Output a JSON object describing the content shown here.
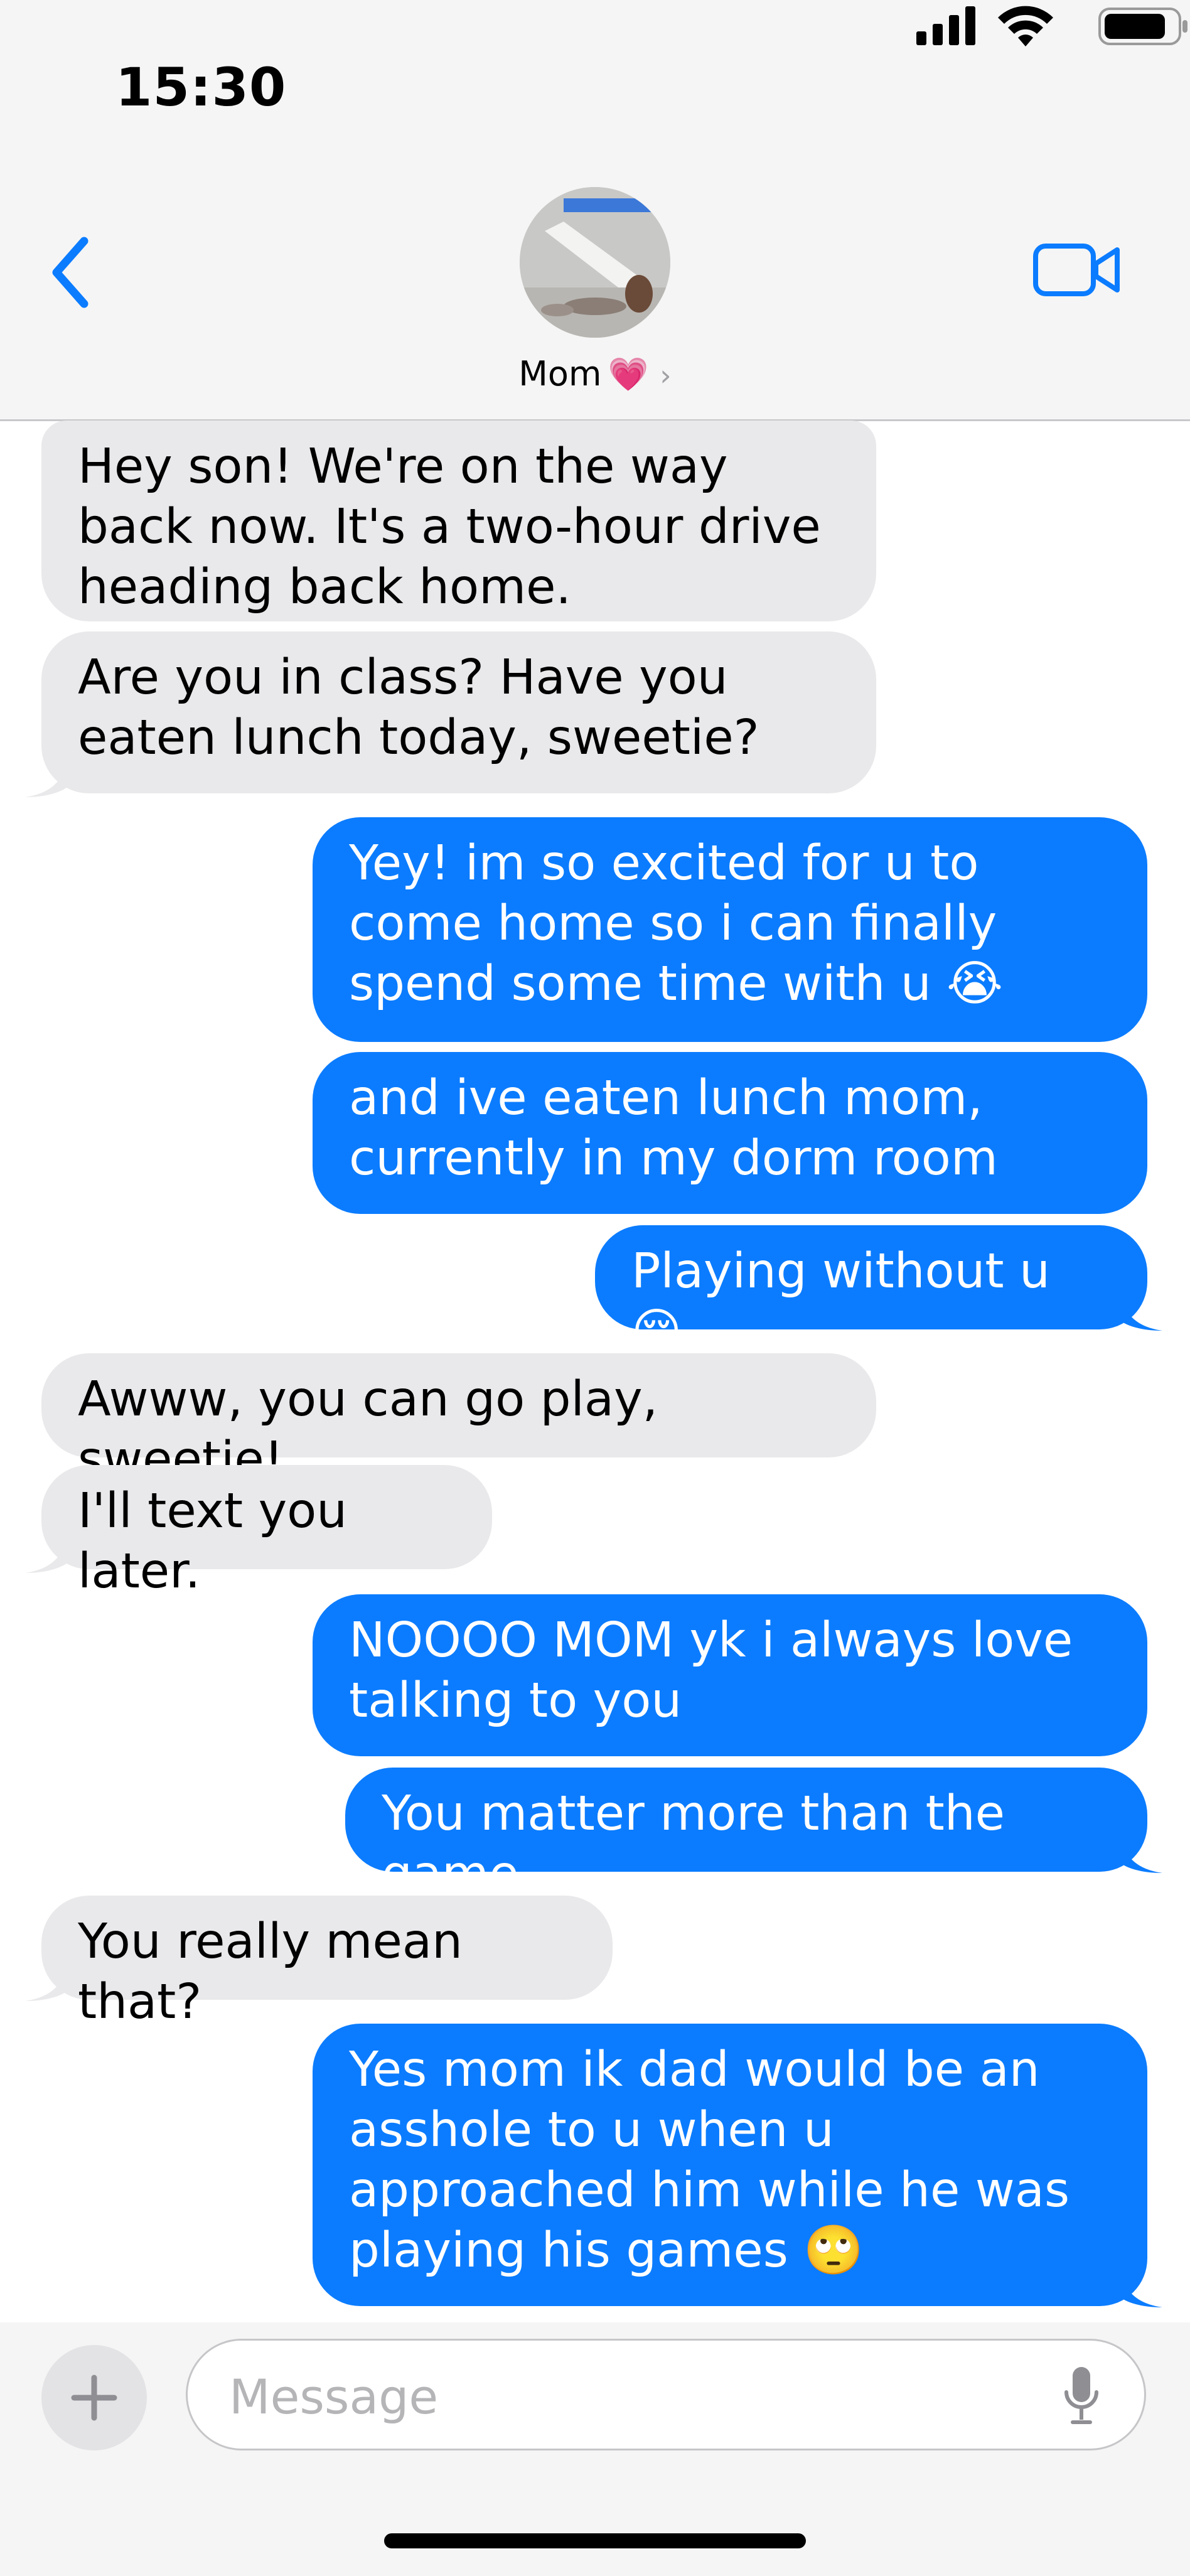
{
  "status_bar": {
    "time": "15:30"
  },
  "header": {
    "contact_name": "Mom",
    "heart_emoji": "💗",
    "chevron": "›",
    "icons": {
      "back": "chevron-left-icon",
      "video": "video-camera-icon"
    },
    "accent_color": "#0b7cff"
  },
  "messages": [
    {
      "from": "them",
      "text": "Hey son! We're on the way back now. It's a two-hour drive heading back home."
    },
    {
      "from": "them",
      "text": "Are you in class? Have you eaten lunch today, sweetie?"
    },
    {
      "from": "me",
      "text": "Yey! im so excited for u to come home so i can finally spend some time with u 😭"
    },
    {
      "from": "me",
      "text": "and ive eaten lunch mom, currently in my dorm room"
    },
    {
      "from": "me",
      "text": "Playing without u 😔"
    },
    {
      "from": "them",
      "text": "Awww, you can go play, sweetie!"
    },
    {
      "from": "them",
      "text": "I'll text you later."
    },
    {
      "from": "me",
      "text": "NOOOO MOM yk i always love talking to you"
    },
    {
      "from": "me",
      "text": "You matter more than the game"
    },
    {
      "from": "them",
      "text": "You really mean that?"
    },
    {
      "from": "me",
      "text": "Yes mom ik dad would be an asshole to u when u approached him while he was playing his games 🙄"
    }
  ],
  "colors": {
    "incoming_bubble": "#e9e9eb",
    "outgoing_bubble": "#0b7cff"
  },
  "input_bar": {
    "placeholder": "Message",
    "add_label": "+",
    "icons": {
      "add": "plus-icon",
      "mic": "microphone-icon"
    }
  }
}
